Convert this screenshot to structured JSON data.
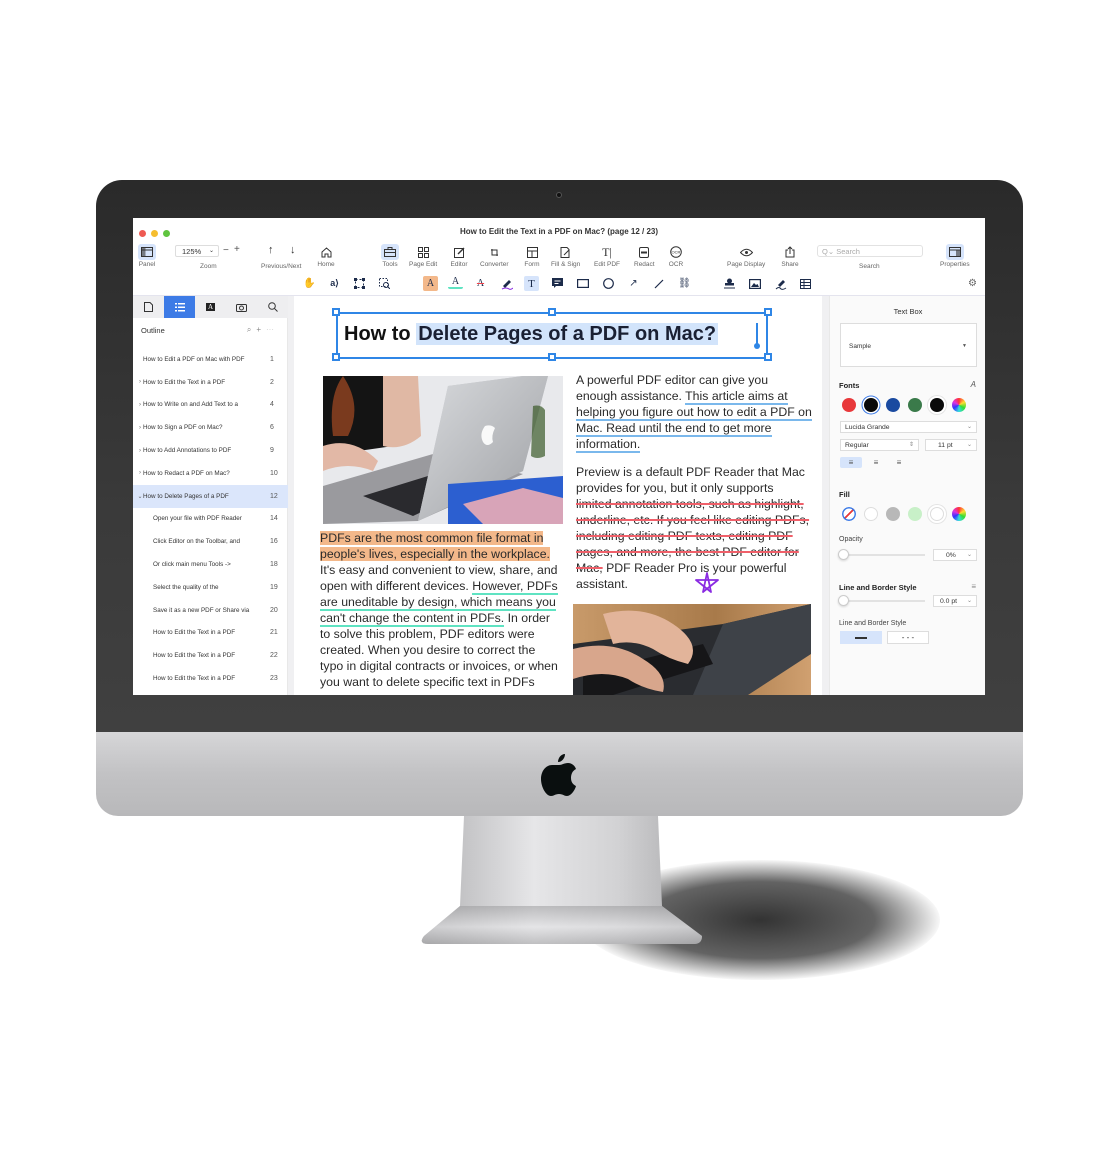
{
  "window": {
    "title": "How to Edit the Text in a PDF on Mac? (page 12 / 23)"
  },
  "toolbar": {
    "panel_label": "Panel",
    "zoom_value": "125%",
    "zoom_label": "Zoom",
    "zoom_minus": "−",
    "zoom_plus": "+",
    "prev_next_label": "Previous/Next",
    "home_label": "Home",
    "tools_label": "Tools",
    "page_edit_label": "Page Edit",
    "editor_label": "Editor",
    "converter_label": "Converter",
    "form_label": "Form",
    "fill_sign_label": "Fill & Sign",
    "edit_pdf_label": "Edit PDF",
    "redact_label": "Redact",
    "ocr_label": "OCR",
    "page_display_label": "Page Display",
    "share_label": "Share",
    "search_placeholder": "Search",
    "search_label": "Search",
    "properties_label": "Properties"
  },
  "annotation_tools": [
    "hand-tool",
    "select-text-tool",
    "select-area-tool",
    "zoom-area-tool",
    "highlight-tool",
    "underline-tool",
    "strikethrough-tool",
    "freehand-tool",
    "text-box-tool",
    "note-tool",
    "rectangle-tool",
    "ellipse-tool",
    "arrow-tool",
    "line-tool",
    "link-tool",
    "stamp-tool",
    "image-tool",
    "signature-tool",
    "table-tool"
  ],
  "active_tool": "text-box-tool",
  "sidebar": {
    "tabs": [
      "thumbnails",
      "outline",
      "annotations",
      "snapshots",
      "search"
    ],
    "active_tab": "outline",
    "heading": "Outline",
    "items": [
      {
        "label": "How to Edit a PDF on Mac with PDF",
        "page": "1",
        "expandable": false,
        "child": false,
        "active": false
      },
      {
        "label": "How to Edit the Text in a PDF",
        "page": "2",
        "expandable": true,
        "child": false,
        "active": false
      },
      {
        "label": "How to Write on and Add Text to a",
        "page": "4",
        "expandable": true,
        "child": false,
        "active": false
      },
      {
        "label": "How to Sign a PDF on Mac?",
        "page": "6",
        "expandable": true,
        "child": false,
        "active": false
      },
      {
        "label": "How to Add Annotations to PDF",
        "page": "9",
        "expandable": true,
        "child": false,
        "active": false
      },
      {
        "label": "How to Redact a PDF on Mac?",
        "page": "10",
        "expandable": true,
        "child": false,
        "active": false
      },
      {
        "label": "How to Delete Pages of a PDF",
        "page": "12",
        "expandable": true,
        "expanded": true,
        "child": false,
        "active": true
      },
      {
        "label": "Open your file with PDF Reader",
        "page": "14",
        "expandable": false,
        "child": true,
        "active": false
      },
      {
        "label": "Click Editor on the Toolbar, and",
        "page": "16",
        "expandable": false,
        "child": true,
        "active": false
      },
      {
        "label": "Or click main menu Tools ->",
        "page": "18",
        "expandable": false,
        "child": true,
        "active": false
      },
      {
        "label": "Select the quality of the",
        "page": "19",
        "expandable": false,
        "child": true,
        "active": false
      },
      {
        "label": "Save it as a new PDF or Share via",
        "page": "20",
        "expandable": false,
        "child": true,
        "active": false
      },
      {
        "label": "How to Edit the Text in a PDF",
        "page": "21",
        "expandable": false,
        "child": true,
        "active": false
      },
      {
        "label": "How to Edit the Text in a PDF",
        "page": "22",
        "expandable": false,
        "child": true,
        "active": false
      },
      {
        "label": "How to Edit the Text in a PDF",
        "page": "23",
        "expandable": false,
        "child": true,
        "active": false
      }
    ]
  },
  "document": {
    "title_plain": "How to ",
    "title_selected": "Delete Pages of a PDF on Mac?",
    "left_column": {
      "highlighted": "PDFs are the most common file format in people's lives, especially in the workplace.",
      "text1": " It's easy and convenient to view, share, and open with different devices. ",
      "underlined": "However, PDFs are uneditable by design, which means you can't change the content in PDFs.",
      "text2": " In order to solve this problem, PDF editors were created. When you desire to correct the typo in digital contracts or invoices, or when you want to delete specific text in PDFs"
    },
    "right_column": {
      "p1_text": "A powerful PDF editor can give you enough assistance. ",
      "p1_underlined": "This article aims at helping you figure out how to edit a PDF on Mac. Read until the end to get more information.",
      "p2_text": "Preview is a default PDF Reader that Mac provides for you, but it only supports ",
      "p2_struck": "limited annotation tools, such as highlight, underline, etc. If you feel like editing PDFs, including editing PDF texts, editing PDF pages, and more, the best PDF editor for Mac,",
      "p2_end": " PDF Reader Pro is your powerful assistant."
    },
    "image1_alt": "person-using-laptop",
    "image2_alt": "hands-typing-on-laptop"
  },
  "properties": {
    "title": "Text Box",
    "sample_label": "Sample",
    "fonts_heading": "Fonts",
    "font_colors": [
      "#e8383a",
      "#0a0a0a",
      "#1a4aa0",
      "#3a7a4a",
      "#0a0a0a"
    ],
    "selected_font_color": "#0a0a0a",
    "font_family": "Lucida Grande",
    "font_style": "Regular",
    "font_size": "11 pt",
    "alignment": "left",
    "fill_heading": "Fill",
    "fill_colors": [
      "none",
      "#ffffff",
      "#b8b8b8",
      "#c8f0c8",
      "#ffffff"
    ],
    "opacity_label": "Opacity",
    "opacity_value": "0%",
    "opacity": 0,
    "line_border_heading": "Line and Border Style",
    "line_width_value": "0.0 pt",
    "line_width": 0,
    "line_border_label": "Line and Border Style",
    "line_styles": [
      "solid",
      "dashed"
    ],
    "selected_line_style": "solid",
    "colors": {
      "accent": "#3d7be6",
      "selection": "#2f86e6",
      "highlight": "#f3b88a",
      "underline_blue": "#7ab8ec",
      "underline_teal": "#5fe3c2",
      "strike": "#f0606a",
      "ink": "#8a2be2"
    }
  }
}
